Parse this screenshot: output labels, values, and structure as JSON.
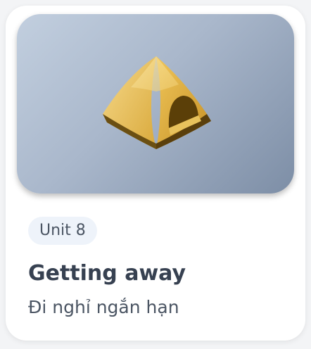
{
  "card": {
    "unit_label": "Unit 8",
    "title": "Getting away",
    "subtitle": "Đi nghỉ ngắn hạn",
    "icon": "tent-icon"
  }
}
